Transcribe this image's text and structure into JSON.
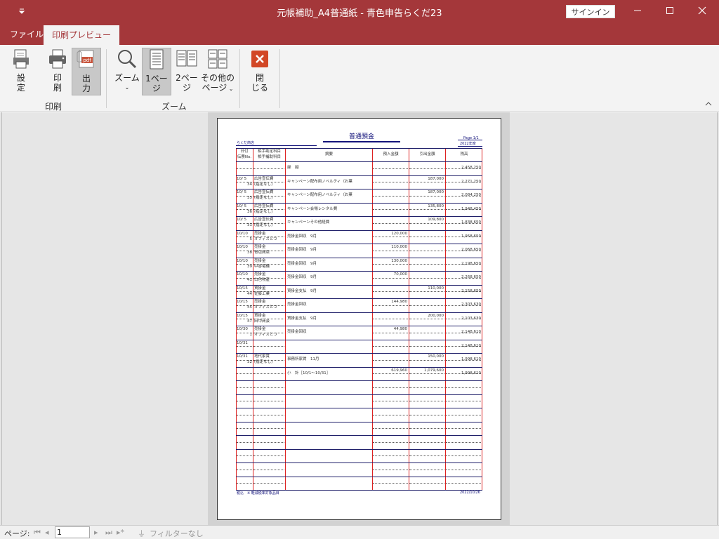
{
  "window": {
    "title": "元帳補助_A4普通紙 - 青色申告らくだ23",
    "signin": "サインイン",
    "qat_icon": "quick-access-down-icon"
  },
  "tabs": [
    {
      "label": "ファイル",
      "active": false
    },
    {
      "label": "印刷プレビュー",
      "active": true
    }
  ],
  "ribbon": {
    "groups": [
      {
        "label": "印刷",
        "buttons": [
          "設\n定",
          "印\n刷",
          "出\n力"
        ]
      },
      {
        "label": "ズーム",
        "buttons": [
          "ズーム",
          "1ペー\nジ",
          "2ペー\nジ",
          "その他の\nページ"
        ]
      },
      {
        "label": "",
        "buttons": [
          "閉\nじる"
        ]
      }
    ],
    "setup_label_1": "設",
    "setup_label_2": "定",
    "print_label_1": "印",
    "print_label_2": "刷",
    "output_label_1": "出",
    "output_label_2": "力",
    "zoom_label": "ズーム",
    "onepage_label_1": "1ペー",
    "onepage_label_2": "ジ",
    "twopage_label_1": "2ペー",
    "twopage_label_2": "ジ",
    "morepages_label_1": "その他の",
    "morepages_label_2": "ページ",
    "close_label_1": "閉",
    "close_label_2": "じる",
    "group_print": "印刷",
    "group_zoom": "ズーム",
    "pdf_text": "pdf"
  },
  "report": {
    "title": "普通預金",
    "company": "らくだ商店",
    "page_info": "Page 1/1",
    "fiscal_year": "2022年度",
    "headers": {
      "date": "日付",
      "voucher": "伝票No.",
      "account": "相手勘定科目",
      "sub_account": "相手補助科目",
      "memo": "摘要",
      "deposit": "預入金額",
      "withdrawal": "引出金額",
      "balance": "残高"
    },
    "rows": [
      {
        "date": "",
        "no": "",
        "acct": "",
        "sub": "",
        "memo": "繰　越",
        "dep": "",
        "wd": "",
        "bal": "2,458,250"
      },
      {
        "date": "10/ 5",
        "no": "34",
        "acct": "広告宣伝費",
        "sub": "(指定なし)",
        "memo": "キャンペーン配布用ノベルティ（お菓",
        "dep": "",
        "wd": "187,000",
        "bal": "2,271,250"
      },
      {
        "date": "10/ 5",
        "no": "35",
        "acct": "広告宣伝費",
        "sub": "(指定なし)",
        "memo": "キャンペーン配布用ノベルティ（お菓",
        "dep": "",
        "wd": "187,000",
        "bal": "2,084,250"
      },
      {
        "date": "10/ 5",
        "no": "36",
        "acct": "広告宣伝費",
        "sub": "(指定なし)",
        "memo": "キャンペーン会場レンタル費",
        "dep": "",
        "wd": "135,800",
        "bal": "1,948,450"
      },
      {
        "date": "10/ 5",
        "no": "31",
        "acct": "広告宣伝費",
        "sub": "(指定なし)",
        "memo": "キャンペーンその他経費",
        "dep": "",
        "wd": "109,800",
        "bal": "1,838,650"
      },
      {
        "date": "10/10",
        "no": "5",
        "acct": "売掛金",
        "sub": "オフィスとつ",
        "memo": "売掛金回収　9月",
        "dep": "120,000",
        "wd": "",
        "bal": "1,958,650"
      },
      {
        "date": "10/10",
        "no": "38",
        "acct": "売掛金",
        "sub": "青色商店",
        "memo": "売掛金回収　9月",
        "dep": "110,000",
        "wd": "",
        "bal": "2,068,650"
      },
      {
        "date": "10/10",
        "no": "39",
        "acct": "売掛金",
        "sub": "中谷電機",
        "memo": "売掛金回収　9月",
        "dep": "130,000",
        "wd": "",
        "bal": "2,198,650"
      },
      {
        "date": "10/10",
        "no": "41",
        "acct": "売掛金",
        "sub": "白色物産",
        "memo": "売掛金回収　9月",
        "dep": "70,000",
        "wd": "",
        "bal": "2,268,650"
      },
      {
        "date": "10/15",
        "no": "44",
        "acct": "買掛金",
        "sub": "佐藤工業",
        "memo": "買掛金支払　9月",
        "dep": "",
        "wd": "110,000",
        "bal": "2,158,650"
      },
      {
        "date": "10/15",
        "no": "45",
        "acct": "売掛金",
        "sub": "オフィスとつ",
        "memo": "売掛金回収",
        "dep": "144,980",
        "wd": "",
        "bal": "2,303,630"
      },
      {
        "date": "10/15",
        "no": "47",
        "acct": "買掛金",
        "sub": "田中商会",
        "memo": "買掛金支払　9月",
        "dep": "",
        "wd": "200,000",
        "bal": "2,103,630"
      },
      {
        "date": "10/30",
        "no": "1",
        "acct": "売掛金",
        "sub": "オフィスとつ",
        "memo": "売掛金回収",
        "dep": "44,980",
        "wd": "",
        "bal": "2,148,610"
      },
      {
        "date": "10/31",
        "no": "",
        "acct": "",
        "sub": "",
        "memo": "",
        "dep": "",
        "wd": "",
        "bal": "2,148,610"
      },
      {
        "date": "10/31",
        "no": "32",
        "acct": "地代家賃",
        "sub": "(指定なし)",
        "memo": "事務所家賃　11月",
        "dep": "",
        "wd": "150,000",
        "bal": "1,998,610"
      },
      {
        "date": "",
        "no": "",
        "acct": "",
        "sub": "",
        "memo": "小　計［10/1～10/31］",
        "dep": "619,960",
        "wd": "1,079,600",
        "bal": "1,998,610"
      }
    ],
    "footer_left": "税込　※ 軽減税率対象品目",
    "footer_right": "2022/10/26"
  },
  "status": {
    "page_label": "ページ:",
    "page_value": "1",
    "filter_label": "フィルターなし"
  }
}
